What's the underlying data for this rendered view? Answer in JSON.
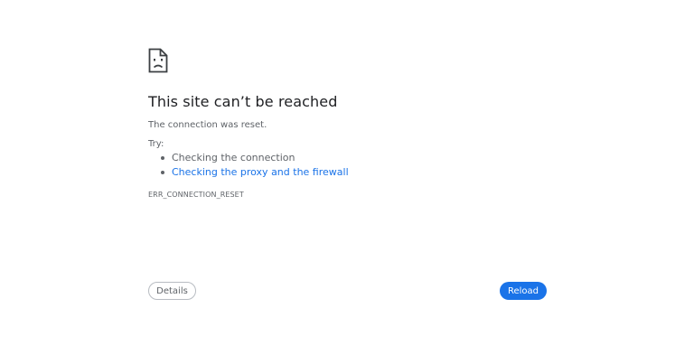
{
  "error": {
    "icon": "sad-document-icon",
    "title": "This site can’t be reached",
    "summary": "The connection was reset.",
    "try_label": "Try:",
    "suggestions": [
      {
        "label": "Checking the connection",
        "is_link": false
      },
      {
        "label": "Checking the proxy and the firewall",
        "is_link": true
      }
    ],
    "code": "ERR_CONNECTION_RESET"
  },
  "buttons": {
    "details_label": "Details",
    "reload_label": "Reload"
  },
  "colors": {
    "accent": "#1a73e8",
    "text_primary": "#202124",
    "text_secondary": "#5f6368",
    "background": "#ffffff"
  }
}
